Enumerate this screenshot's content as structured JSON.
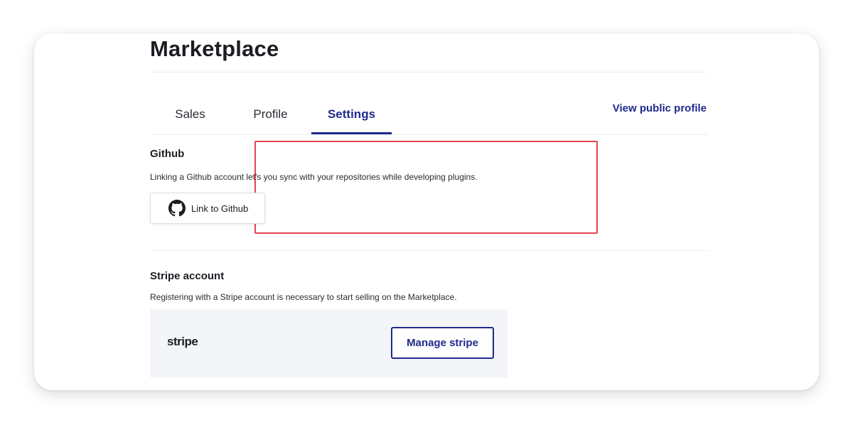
{
  "page": {
    "title": "Marketplace"
  },
  "tabs": [
    {
      "label": "Sales",
      "active": false
    },
    {
      "label": "Profile",
      "active": false
    },
    {
      "label": "Settings",
      "active": true
    }
  ],
  "header_link": "View public profile",
  "github": {
    "title": "Github",
    "description": "Linking a Github account let's you sync with your repositories while developing plugins.",
    "button_label": "Link to Github",
    "icon": "github-icon"
  },
  "stripe": {
    "title": "Stripe account",
    "description": "Registering with a Stripe account is necessary to start selling on the Marketplace.",
    "logo_text": "stripe",
    "button_label": "Manage stripe"
  },
  "colors": {
    "accent": "#1f2a8c",
    "highlight": "#e5434f",
    "panel": "#f3f5f8"
  }
}
